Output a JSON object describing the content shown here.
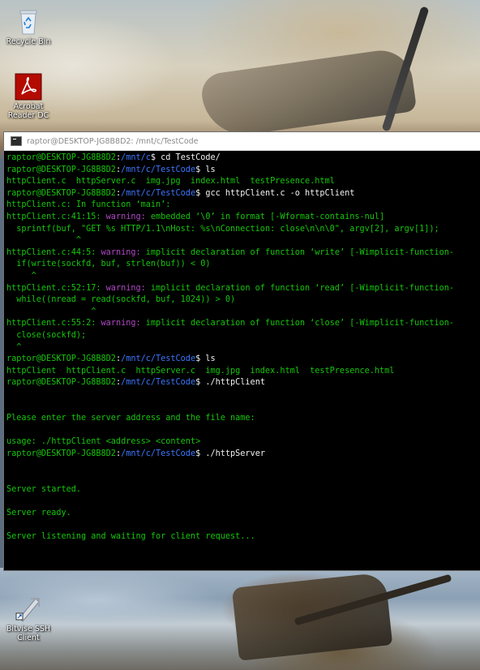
{
  "window": {
    "title": "raptor@DESKTOP-JG8B8D2: /mnt/c/TestCode"
  },
  "desktop_icons": [
    {
      "label_lines": [
        "Recycle Bin"
      ],
      "icon": "recycle-bin-icon"
    },
    {
      "label_lines": [
        "Acrobat",
        "Reader DC"
      ],
      "icon": "acrobat-reader-icon"
    },
    {
      "label_lines": [
        "Bitvise SSH",
        "Client"
      ],
      "icon": "bitvise-ssh-icon"
    }
  ],
  "colors": {
    "prompt_user": "#16c60c",
    "prompt_path": "#3b78ff",
    "output_text": "#16c60c",
    "warning": "#b148c6",
    "terminal_bg": "#000000"
  },
  "terminal": {
    "lines": [
      {
        "parts": [
          {
            "t": "raptor@DESKTOP-JG8B8D2",
            "c": "g"
          },
          {
            "t": ":",
            "c": "w"
          },
          {
            "t": "/mnt/c",
            "c": "b"
          },
          {
            "t": "$ cd TestCode/",
            "c": "w"
          }
        ]
      },
      {
        "parts": [
          {
            "t": "raptor@DESKTOP-JG8B8D2",
            "c": "g"
          },
          {
            "t": ":",
            "c": "w"
          },
          {
            "t": "/mnt/c/TestCode",
            "c": "b"
          },
          {
            "t": "$ ls",
            "c": "w"
          }
        ]
      },
      {
        "parts": [
          {
            "t": "httpClient.c  httpServer.c  img.jpg  index.html  testPresence.html",
            "c": "g"
          }
        ]
      },
      {
        "parts": [
          {
            "t": "raptor@DESKTOP-JG8B8D2",
            "c": "g"
          },
          {
            "t": ":",
            "c": "w"
          },
          {
            "t": "/mnt/c/TestCode",
            "c": "b"
          },
          {
            "t": "$ gcc httpClient.c -o httpClient",
            "c": "w"
          }
        ]
      },
      {
        "parts": [
          {
            "t": "httpClient.c: In function ‘main’:",
            "c": "g"
          }
        ]
      },
      {
        "parts": [
          {
            "t": "httpClient.c:41:15: ",
            "c": "g"
          },
          {
            "t": "warning: ",
            "c": "m"
          },
          {
            "t": "embedded ‘\\0’ in format [-Wformat-contains-nul]",
            "c": "g"
          }
        ]
      },
      {
        "parts": [
          {
            "t": "  sprintf(buf, \"GET %s HTTP/1.1\\nHost: %s\\nConnection: close\\n\\n\\0\", argv[2], argv[1]);",
            "c": "g"
          }
        ]
      },
      {
        "parts": [
          {
            "t": "              ^",
            "c": "g"
          }
        ]
      },
      {
        "parts": [
          {
            "t": "httpClient.c:44:5: ",
            "c": "g"
          },
          {
            "t": "warning: ",
            "c": "m"
          },
          {
            "t": "implicit declaration of function ‘write’ [-Wimplicit-function-",
            "c": "g"
          }
        ]
      },
      {
        "parts": [
          {
            "t": "  if(write(sockfd, buf, strlen(buf)) < 0)",
            "c": "g"
          }
        ]
      },
      {
        "parts": [
          {
            "t": "     ^",
            "c": "g"
          }
        ]
      },
      {
        "parts": [
          {
            "t": "httpClient.c:52:17: ",
            "c": "g"
          },
          {
            "t": "warning: ",
            "c": "m"
          },
          {
            "t": "implicit declaration of function ‘read’ [-Wimplicit-function-",
            "c": "g"
          }
        ]
      },
      {
        "parts": [
          {
            "t": "  while((nread = read(sockfd, buf, 1024)) > 0)",
            "c": "g"
          }
        ]
      },
      {
        "parts": [
          {
            "t": "                 ^",
            "c": "g"
          }
        ]
      },
      {
        "parts": [
          {
            "t": "httpClient.c:55:2: ",
            "c": "g"
          },
          {
            "t": "warning: ",
            "c": "m"
          },
          {
            "t": "implicit declaration of function ‘close’ [-Wimplicit-function-",
            "c": "g"
          }
        ]
      },
      {
        "parts": [
          {
            "t": "  close(sockfd);",
            "c": "g"
          }
        ]
      },
      {
        "parts": [
          {
            "t": "  ^",
            "c": "g"
          }
        ]
      },
      {
        "parts": [
          {
            "t": "raptor@DESKTOP-JG8B8D2",
            "c": "g"
          },
          {
            "t": ":",
            "c": "w"
          },
          {
            "t": "/mnt/c/TestCode",
            "c": "b"
          },
          {
            "t": "$ ls",
            "c": "w"
          }
        ]
      },
      {
        "parts": [
          {
            "t": "httpClient  httpClient.c  httpServer.c  img.jpg  index.html  testPresence.html",
            "c": "g"
          }
        ]
      },
      {
        "parts": [
          {
            "t": "raptor@DESKTOP-JG8B8D2",
            "c": "g"
          },
          {
            "t": ":",
            "c": "w"
          },
          {
            "t": "/mnt/c/TestCode",
            "c": "b"
          },
          {
            "t": "$ ./httpClient",
            "c": "w"
          }
        ]
      },
      {
        "parts": []
      },
      {
        "parts": []
      },
      {
        "parts": [
          {
            "t": "Please enter the server address and the file name:",
            "c": "g"
          }
        ]
      },
      {
        "parts": []
      },
      {
        "parts": [
          {
            "t": "usage: ./httpClient <address> <content>",
            "c": "g"
          }
        ]
      },
      {
        "parts": [
          {
            "t": "raptor@DESKTOP-JG8B8D2",
            "c": "g"
          },
          {
            "t": ":",
            "c": "w"
          },
          {
            "t": "/mnt/c/TestCode",
            "c": "b"
          },
          {
            "t": "$ ./httpServer",
            "c": "w"
          }
        ]
      },
      {
        "parts": []
      },
      {
        "parts": []
      },
      {
        "parts": [
          {
            "t": "Server started.",
            "c": "g"
          }
        ]
      },
      {
        "parts": []
      },
      {
        "parts": [
          {
            "t": "Server ready.",
            "c": "g"
          }
        ]
      },
      {
        "parts": []
      },
      {
        "parts": [
          {
            "t": "Server listening and waiting for client request...",
            "c": "g"
          }
        ]
      }
    ]
  }
}
